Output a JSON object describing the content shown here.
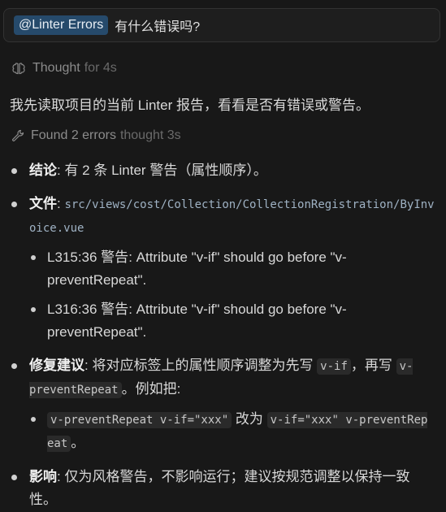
{
  "message": {
    "mention": "@Linter Errors",
    "text": "有什么错误吗?"
  },
  "thought": {
    "label": "Thought",
    "duration": "for 4s",
    "icon": "brain-icon"
  },
  "intro": "我先读取项目的当前 Linter 报告，看看是否有错误或警告。",
  "tool": {
    "label": "Found 2 errors",
    "duration": "thought 3s",
    "icon": "wrench-icon"
  },
  "answer": {
    "conclusion": {
      "label": "结论",
      "text": ": 有 2 条 Linter 警告（属性顺序）。"
    },
    "file": {
      "label": "文件",
      "sep": ": ",
      "path": "src/views/cost/Collection/CollectionRegistration/ByInvoice.vue"
    },
    "warnings": [
      {
        "loc": "L315:36 警告",
        "text": ": Attribute \"v-if\" should go before \"v-preventRepeat\"."
      },
      {
        "loc": "L316:36 警告",
        "text": ": Attribute \"v-if\" should go before \"v-preventRepeat\"."
      }
    ],
    "fix": {
      "label": "修复建议",
      "text1": ": 将对应标签上的属性顺序调整为先写 ",
      "code1": "v-if",
      "text2": "，再写 ",
      "code2": "v-preventRepeat",
      "text3": "。例如把:",
      "example_before": "v-preventRepeat v-if=\"xxx\"",
      "example_mid": " 改为 ",
      "example_after": "v-if=\"xxx\" v-preventRepeat",
      "example_end": "。"
    },
    "impact": {
      "label": "影响",
      "text": ": 仅为风格警告，不影响运行；建议按规范调整以保持一致性。"
    }
  }
}
